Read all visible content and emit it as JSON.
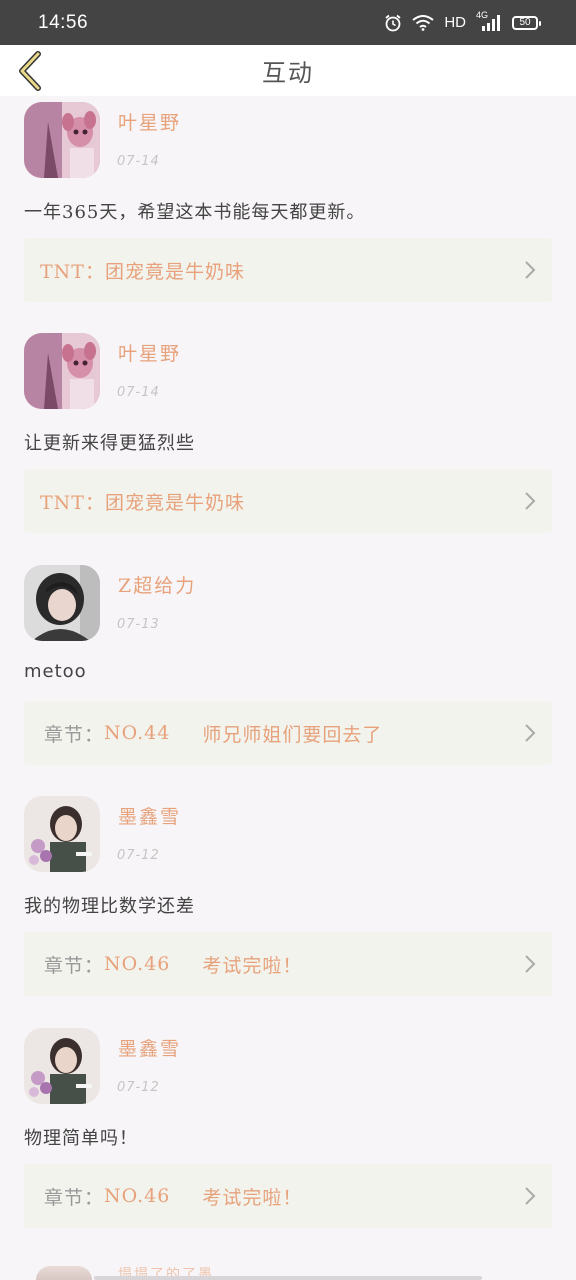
{
  "status_bar": {
    "time": "14:56",
    "network": "HD",
    "signal_label": "4G",
    "battery": "50"
  },
  "header": {
    "title": "互动"
  },
  "items": [
    {
      "name": "叶星野",
      "date": "07-14",
      "content": "一年365天，希望这本书能每天都更新。",
      "ref_label": "TNT：",
      "ref_number": "",
      "ref_text": "团宠竟是牛奶味"
    },
    {
      "name": "叶星野",
      "date": "07-14",
      "content": "让更新来得更猛烈些",
      "ref_label": "TNT：",
      "ref_number": "",
      "ref_text": "团宠竟是牛奶味"
    },
    {
      "name": "Z超给力",
      "date": "07-13",
      "content": "metoo",
      "ref_label": "章节：",
      "ref_number": "NO.44",
      "ref_text": "师兄师姐们要回去了"
    },
    {
      "name": "墨鑫雪",
      "date": "07-12",
      "content": "我的物理比数学还差",
      "ref_label": "章节：",
      "ref_number": "NO.46",
      "ref_text": "考试完啦！"
    },
    {
      "name": "墨鑫雪",
      "date": "07-12",
      "content": "物理简单吗！",
      "ref_label": "章节：",
      "ref_number": "NO.46",
      "ref_text": "考试完啦！"
    }
  ],
  "bottom_peek": {
    "name": "塌塌了的了墨"
  },
  "colors": {
    "accent": "#e7a27c",
    "status_bar": "#444444",
    "card_bg": "#f3f3ed",
    "page_bg": "#f7f5f7"
  }
}
